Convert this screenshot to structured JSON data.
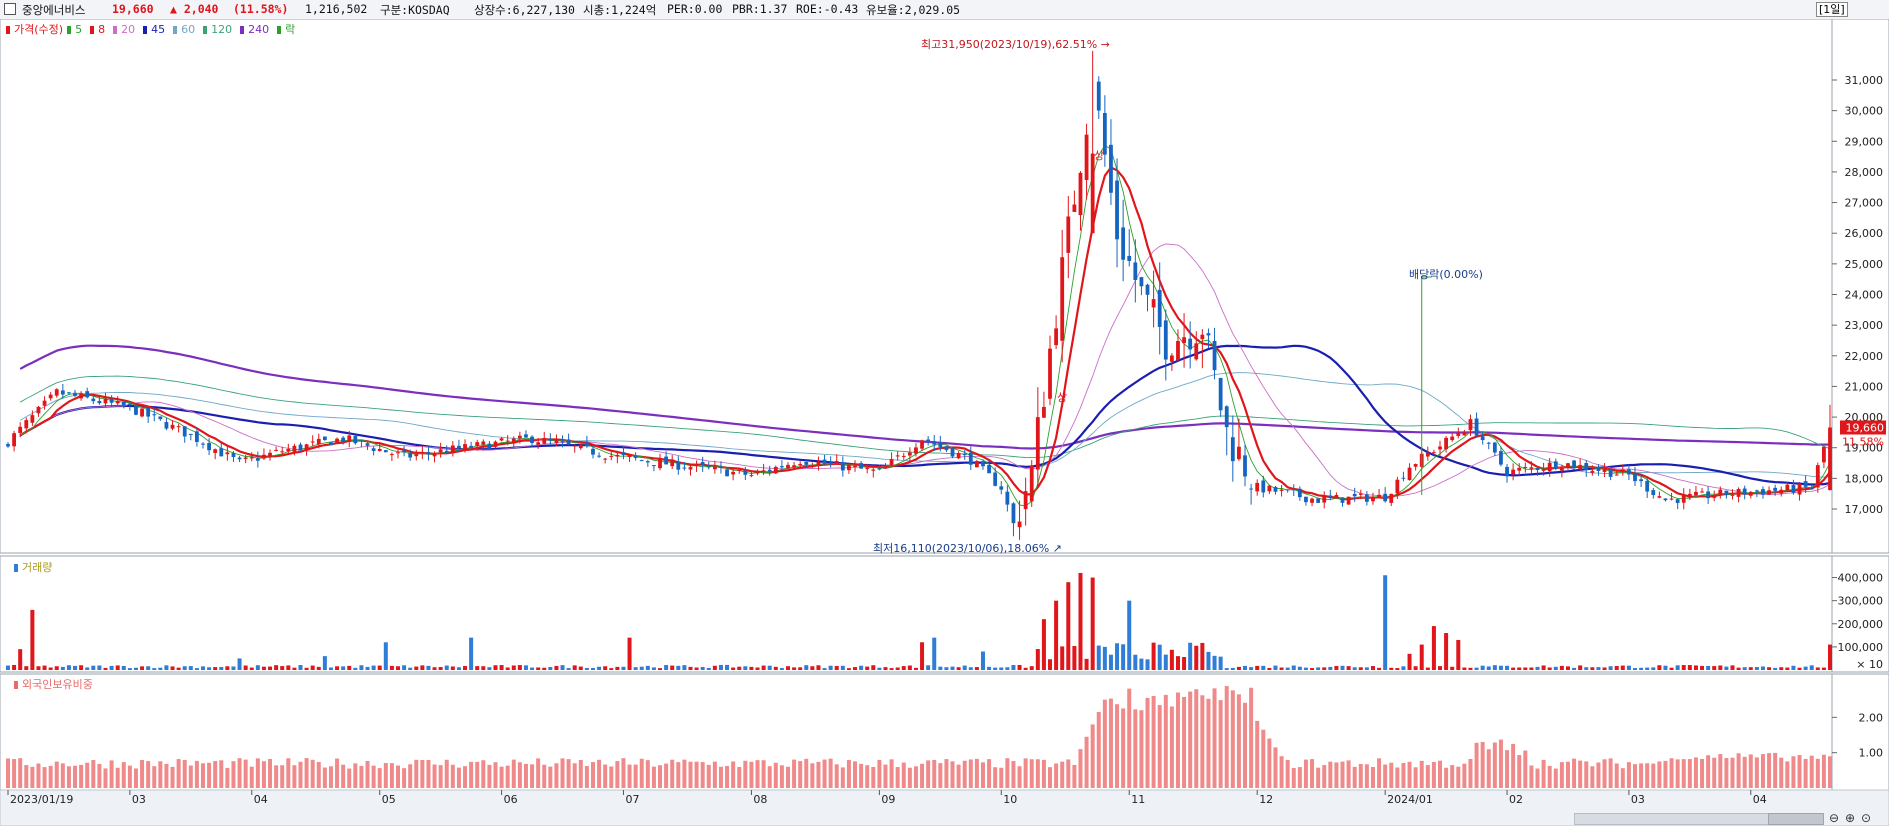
{
  "header": {
    "stock_name": "중앙에너비스",
    "price": "19,660",
    "change": "▲ 2,040",
    "change_pct": "(11.58%)",
    "volume": "1,216,502",
    "market": "구분:KOSDAQ",
    "shares": "상장수:6,227,130",
    "market_cap": "시총:1,224억",
    "per": "PER:0.00",
    "pbr": "PBR:1.37",
    "roe": "ROE:-0.43",
    "float_ratio": "유보율:2,029.05",
    "period": "[1일]",
    "colors": {
      "up": "#e0161b",
      "down": "#1565c0",
      "name": "#111111"
    }
  },
  "price_panel": {
    "legend_title": "가격(수정)",
    "ma_legend": [
      {
        "label": "5",
        "color": "#2ca02c"
      },
      {
        "label": "8",
        "color": "#e0161b"
      },
      {
        "label": "20",
        "color": "#c96fc6"
      },
      {
        "label": "45",
        "color": "#1a1fb0"
      },
      {
        "label": "60",
        "color": "#6fa8c8"
      },
      {
        "label": "120",
        "color": "#3aa37a"
      },
      {
        "label": "240",
        "color": "#7b2fbf"
      },
      {
        "label": "락",
        "color": "#2ca02c"
      }
    ],
    "high_label": "최고31,950(2023/10/19),62.51%",
    "low_label": "최저16,110(2023/10/06),18.06%",
    "dividend_label": "배당락(0.00%)",
    "event_label_1": "상",
    "event_label_2": "상",
    "last_price_tag": "19,660",
    "last_pct_tag": "11.58%",
    "y_ticks": [
      "31,000",
      "30,000",
      "29,000",
      "28,000",
      "27,000",
      "26,000",
      "25,000",
      "24,000",
      "23,000",
      "22,000",
      "21,000",
      "20,000",
      "19,000",
      "18,000",
      "17,000"
    ]
  },
  "volume_panel": {
    "title": "거래량",
    "y_ticks": [
      "400,000",
      "300,000",
      "200,000",
      "100,000"
    ],
    "multiplier": "× 10"
  },
  "foreign_panel": {
    "title": "외국인보유비중",
    "y_ticks": [
      "2.00",
      "1.00"
    ]
  },
  "x_axis": {
    "labels": [
      "2023/01/19",
      "03",
      "04",
      "05",
      "06",
      "07",
      "08",
      "09",
      "10",
      "11",
      "12",
      "2024/01",
      "02",
      "03",
      "04"
    ]
  },
  "chart_data": {
    "type": "candlestick",
    "title": "중앙에너비스",
    "x_labels": [
      "2023/01/19",
      "03",
      "04",
      "05",
      "06",
      "07",
      "08",
      "09",
      "10",
      "11",
      "12",
      "2024/01",
      "02",
      "03",
      "04"
    ],
    "ylim": [
      16000,
      32000
    ],
    "price_anchors": [
      {
        "x": "2023/01/19",
        "close": 19200
      },
      {
        "x": "03",
        "close": 20300
      },
      {
        "x": "04",
        "close": 18700
      },
      {
        "x": "05",
        "close": 19300
      },
      {
        "x": "06",
        "close": 19100
      },
      {
        "x": "07",
        "close": 18500
      },
      {
        "x": "08",
        "close": 18300
      },
      {
        "x": "09",
        "close": 18200
      },
      {
        "x": "10",
        "close": 16500
      },
      {
        "x": "2023/10/19",
        "close": 31950
      },
      {
        "x": "11",
        "close": 22700
      },
      {
        "x": "12",
        "close": 17400
      },
      {
        "x": "2024/01",
        "close": 18000
      },
      {
        "x": "02",
        "close": 18300
      },
      {
        "x": "03",
        "close": 17600
      },
      {
        "x": "04",
        "close": 19660
      }
    ],
    "high": {
      "value": 31950,
      "date": "2023/10/19",
      "pct": 62.51
    },
    "low": {
      "value": 16110,
      "date": "2023/10/06",
      "pct": 18.06
    },
    "last_close": 19660,
    "moving_averages": [
      5,
      8,
      20,
      45,
      60,
      120,
      240
    ],
    "volume_ylim": [
      0,
      450000
    ],
    "volume_peaks": [
      {
        "x": "10",
        "value": 420000
      },
      {
        "x": "2024/01",
        "value": 410000
      },
      {
        "x": "04",
        "value": 100000
      }
    ],
    "foreign_ratio_ylim": [
      0,
      3
    ],
    "foreign_ratio_peak": {
      "x": "10",
      "value": 2.9
    }
  }
}
